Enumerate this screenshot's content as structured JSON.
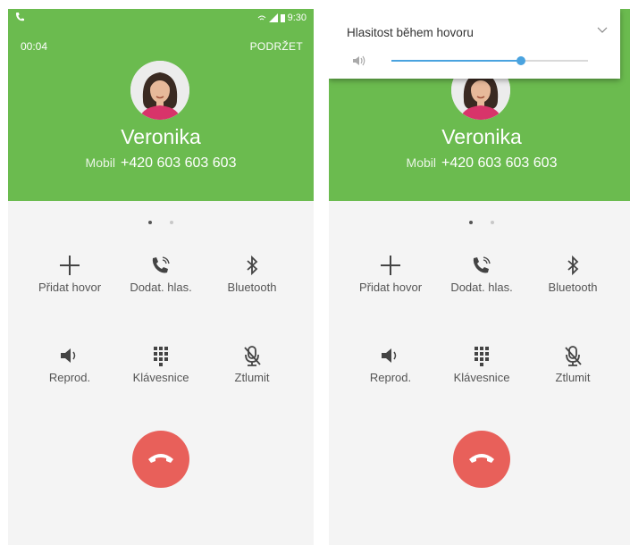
{
  "panels": [
    {
      "status_time": "9:30",
      "call_timer": "00:04",
      "hold_label": "PODRŽET",
      "contact_name": "Veronika",
      "number_label": "Mobil",
      "phone_number": "+420 603 603 603",
      "page_indicator": {
        "pages": 2,
        "active": 0
      },
      "buttons": [
        {
          "label": "Přidat hovor",
          "icon": "plus-icon"
        },
        {
          "label": "Dodat. hlas.",
          "icon": "extra-volume-icon"
        },
        {
          "label": "Bluetooth",
          "icon": "bluetooth-icon"
        },
        {
          "label": "Reprod.",
          "icon": "speaker-icon"
        },
        {
          "label": "Klávesnice",
          "icon": "keypad-icon"
        },
        {
          "label": "Ztlumit",
          "icon": "mute-icon"
        }
      ],
      "end_call_icon": "end-call-icon"
    },
    {
      "contact_name": "Veronika",
      "number_label": "Mobil",
      "phone_number": "+420 603 603 603",
      "page_indicator": {
        "pages": 2,
        "active": 0
      },
      "volume_popup": {
        "title": "Hlasitost během hovoru",
        "level": 0.66,
        "expand_icon": "chevron-down-icon"
      },
      "buttons": [
        {
          "label": "Přidat hovor",
          "icon": "plus-icon"
        },
        {
          "label": "Dodat. hlas.",
          "icon": "extra-volume-icon"
        },
        {
          "label": "Bluetooth",
          "icon": "bluetooth-icon"
        },
        {
          "label": "Reprod.",
          "icon": "speaker-icon"
        },
        {
          "label": "Klávesnice",
          "icon": "keypad-icon"
        },
        {
          "label": "Ztlumit",
          "icon": "mute-icon"
        }
      ],
      "end_call_icon": "end-call-icon"
    }
  ],
  "colors": {
    "header_green": "#6bbb4f",
    "end_call_red": "#e8605a",
    "slider_blue": "#4aa3df",
    "background": "#f4f4f4"
  }
}
